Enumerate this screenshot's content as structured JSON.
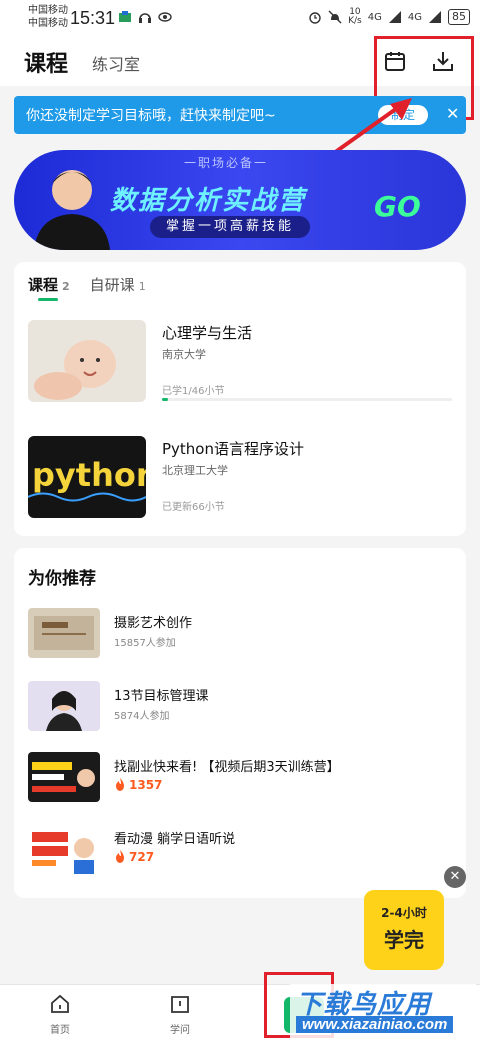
{
  "status_bar": {
    "carrier1": "中国移动",
    "carrier2": "中国移动",
    "time": "15:31",
    "net_speed_value": "10",
    "net_speed_unit": "K/s",
    "signal1": "4G",
    "signal2": "4G",
    "battery": "85"
  },
  "header": {
    "tab_active": "课程",
    "tab_other": "练习室"
  },
  "goal_banner": {
    "text": "你还没制定学习目标哦，赶快来制定吧~",
    "button": "制定"
  },
  "promo": {
    "kicker": "一职场必备一",
    "title": "数据分析实战营",
    "pill": "掌握一项高薪技能",
    "go": "GO"
  },
  "courses": {
    "tabs": [
      {
        "label": "课程",
        "count": "2"
      },
      {
        "label": "自研课",
        "count": "1"
      }
    ],
    "items": [
      {
        "title": "心理学与生活",
        "school": "南京大学",
        "status": "已学1/46小节",
        "progress": 0.02
      },
      {
        "title": "Python语言程序设计",
        "school": "北京理工大学",
        "status": "已更新66小节",
        "thumb_text": "python"
      }
    ]
  },
  "recommend": {
    "heading": "为你推荐",
    "items": [
      {
        "title": "摄影艺术创作",
        "sub": "15857人参加"
      },
      {
        "title": "13节目标管理课",
        "sub": "5874人参加"
      },
      {
        "title": "找副业快来看!  【视频后期3天训练营】",
        "hot": "1357"
      },
      {
        "title": "看动漫 躺学日语听说",
        "hot": "727"
      }
    ]
  },
  "float_ad": {
    "line1": "2-4小时",
    "line2": "学完"
  },
  "bottom_nav": {
    "home": "首页",
    "learn": "学问"
  },
  "watermark": {
    "top": "下载鸟应用",
    "bottom": "www.xiazainiao.com"
  },
  "colors": {
    "accent_green": "#12b76a",
    "banner_blue": "#1e9ae8",
    "highlight_red": "#e0202a"
  }
}
